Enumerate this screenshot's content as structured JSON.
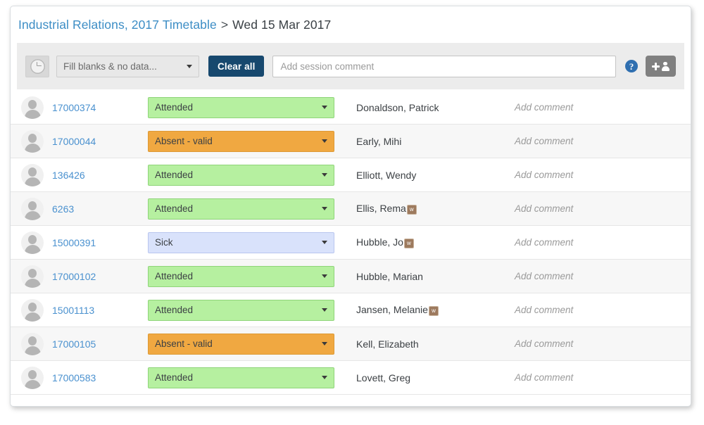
{
  "breadcrumb": {
    "link_label": "Industrial Relations, 2017 Timetable",
    "separator": ">",
    "current_label": "Wed 15 Mar 2017"
  },
  "toolbar": {
    "clock_icon": "clock-icon",
    "filter_select_value": "Fill blanks & no data...",
    "clear_all_label": "Clear all",
    "session_comment_value": "",
    "session_comment_placeholder": "Add session comment",
    "help_icon_label": "?",
    "add_person_icon": "add-person-icon"
  },
  "colors": {
    "attended_bg": "#b6f0a0",
    "attended_border": "#8fd47a",
    "absent_bg": "#f0a841",
    "absent_border": "#dd9a36",
    "sick_bg": "#d9e2fb",
    "sick_border": "#b9c6ef",
    "link_blue": "#4a91cf",
    "clear_all_navy": "#17486e",
    "toolbar_gray": "#ececec"
  },
  "comment_placeholder": "Add comment",
  "rows": [
    {
      "id": "17000374",
      "status": "Attended",
      "status_type": "attended",
      "name": "Donaldson, Patrick",
      "flag": "",
      "comment": ""
    },
    {
      "id": "17000044",
      "status": "Absent - valid",
      "status_type": "absent",
      "name": "Early, Mihi",
      "flag": "",
      "comment": ""
    },
    {
      "id": "136426",
      "status": "Attended",
      "status_type": "attended",
      "name": "Elliott, Wendy",
      "flag": "",
      "comment": ""
    },
    {
      "id": "6263",
      "status": "Attended",
      "status_type": "attended",
      "name": "Ellis, Rema",
      "flag": "w",
      "comment": ""
    },
    {
      "id": "15000391",
      "status": "Sick",
      "status_type": "sick",
      "name": "Hubble, Jo",
      "flag": "w",
      "comment": ""
    },
    {
      "id": "17000102",
      "status": "Attended",
      "status_type": "attended",
      "name": "Hubble, Marian",
      "flag": "",
      "comment": ""
    },
    {
      "id": "15001113",
      "status": "Attended",
      "status_type": "attended",
      "name": "Jansen, Melanie",
      "flag": "w",
      "comment": ""
    },
    {
      "id": "17000105",
      "status": "Absent - valid",
      "status_type": "absent",
      "name": "Kell, Elizabeth",
      "flag": "",
      "comment": ""
    },
    {
      "id": "17000583",
      "status": "Attended",
      "status_type": "attended",
      "name": "Lovett, Greg",
      "flag": "",
      "comment": ""
    }
  ]
}
